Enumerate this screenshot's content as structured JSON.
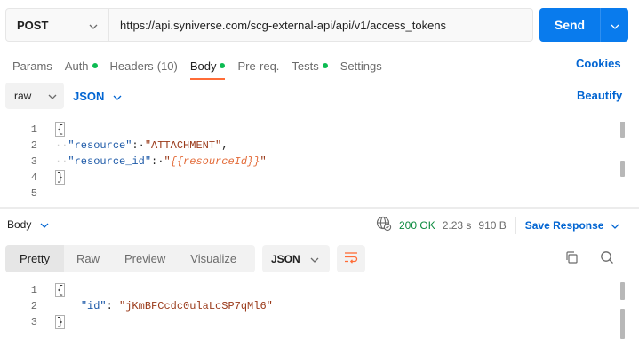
{
  "request": {
    "method": "POST",
    "url": "https://api.syniverse.com/scg-external-api/api/v1/access_tokens",
    "send_label": "Send"
  },
  "tabs": [
    {
      "label": "Params"
    },
    {
      "label": "Auth"
    },
    {
      "label": "Headers",
      "count": "(10)"
    },
    {
      "label": "Body"
    },
    {
      "label": "Pre-req."
    },
    {
      "label": "Tests"
    },
    {
      "label": "Settings"
    }
  ],
  "cookies_label": "Cookies",
  "body_options": {
    "mode": "raw",
    "format": "JSON",
    "beautify_label": "Beautify"
  },
  "request_body": {
    "line_numbers": [
      "1",
      "2",
      "3",
      "4",
      "5"
    ],
    "open_brace": "{",
    "key1": "\"resource\"",
    "val1": "\"ATTACHMENT\"",
    "key2": "\"resource_id\"",
    "val2_quote": "\"",
    "val2_var": "{{resourceId}}",
    "close_brace": "}"
  },
  "response": {
    "label": "Body",
    "status": "200 OK",
    "time": "2.23 s",
    "size": "910 B",
    "save_label": "Save Response",
    "view_tabs": [
      "Pretty",
      "Raw",
      "Preview",
      "Visualize"
    ],
    "format": "JSON",
    "line_numbers": [
      "1",
      "2",
      "3"
    ],
    "open_brace": "{",
    "key": "\"id\"",
    "value": "\"jKmBFCcdc0ulaLcSP7qMl6\"",
    "close_brace": "}"
  },
  "icons": {
    "method_dropdown": "chevron-down-icon",
    "send_dropdown": "chevron-down-icon",
    "globe": "globe-icon",
    "wrap": "wrap-lines-icon",
    "copy": "copy-icon",
    "search": "search-icon"
  },
  "colors": {
    "accent": "#097bed",
    "link": "#0265d2",
    "active_tab": "#ff6c37",
    "status_dot": "#0cbb52",
    "string_variable": "#e36c3a",
    "status_ok": "#0b8a3e"
  }
}
